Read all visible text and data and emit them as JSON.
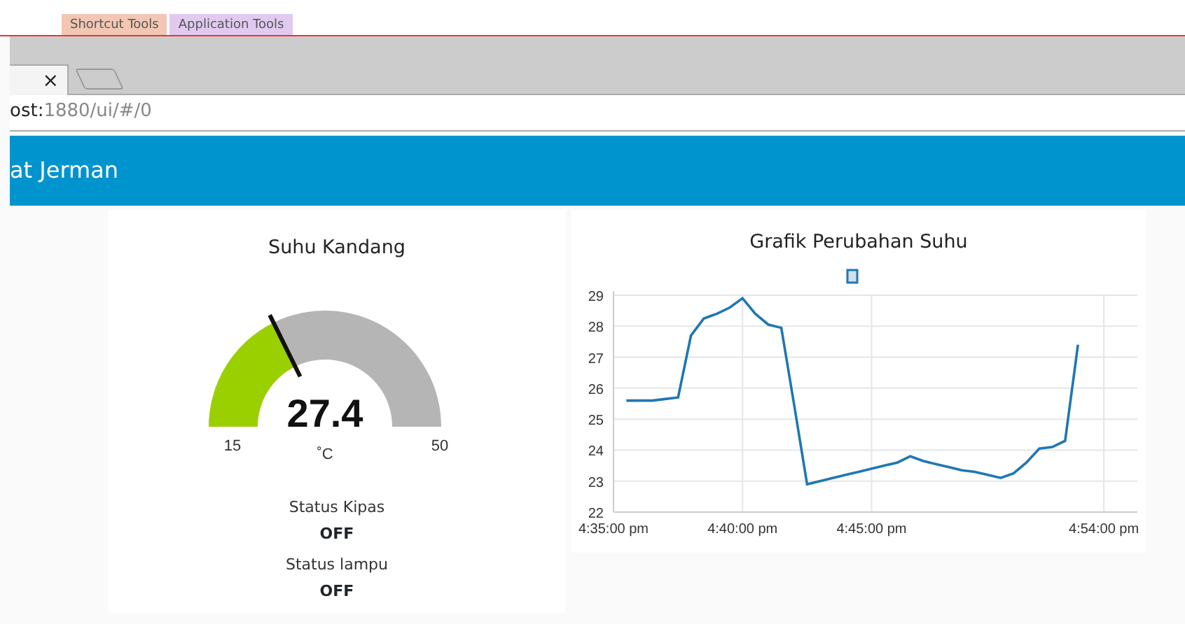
{
  "ribbon_tabs": [
    {
      "label": "Shortcut Tools",
      "color": "#f3c7b4"
    },
    {
      "label": "Application Tools",
      "color": "#e1c9f0"
    }
  ],
  "browser_tab": {
    "close": "×"
  },
  "address_bar": {
    "host": "ost:",
    "path": "1880/ui/#/0"
  },
  "header": {
    "title": "at Jerman"
  },
  "gauge_card": {
    "title": "Suhu Kandang",
    "value": "27.4",
    "unit": "˚C",
    "min": "15",
    "max": "50",
    "level": 0.354,
    "statuses": [
      {
        "label": "Status Kipas",
        "value": "OFF"
      },
      {
        "label": "Status lampu",
        "value": "OFF"
      }
    ]
  },
  "chart_card": {
    "title": "Grafik Perubahan Suhu",
    "chart_data": {
      "type": "line",
      "grid": true,
      "ylim": [
        22,
        29
      ],
      "yticks": [
        22,
        23,
        24,
        25,
        26,
        27,
        28,
        29
      ],
      "categories": [
        "4:35:00 pm",
        null,
        null,
        null,
        null,
        null,
        null,
        null,
        null,
        null,
        "4:40:00 pm",
        null,
        null,
        null,
        null,
        null,
        null,
        null,
        null,
        null,
        "4:45:00 pm",
        null,
        null,
        null,
        null,
        null,
        null,
        null,
        null,
        null,
        null,
        null,
        null,
        null,
        null,
        null,
        null,
        null,
        "4:54:00 pm",
        null,
        null
      ],
      "series": [
        {
          "color": "#1f77b4",
          "values": [
            null,
            25.6,
            25.6,
            25.6,
            25.65,
            25.7,
            27.7,
            28.25,
            28.4,
            28.6,
            28.9,
            28.4,
            28.05,
            27.95,
            25.45,
            22.9,
            23.0,
            23.1,
            23.2,
            23.3,
            23.4,
            23.5,
            23.6,
            23.8,
            23.65,
            23.55,
            23.45,
            23.35,
            23.3,
            23.2,
            23.1,
            23.25,
            23.6,
            24.05,
            24.1,
            24.3,
            27.4,
            null,
            null,
            null,
            null
          ]
        }
      ]
    }
  }
}
